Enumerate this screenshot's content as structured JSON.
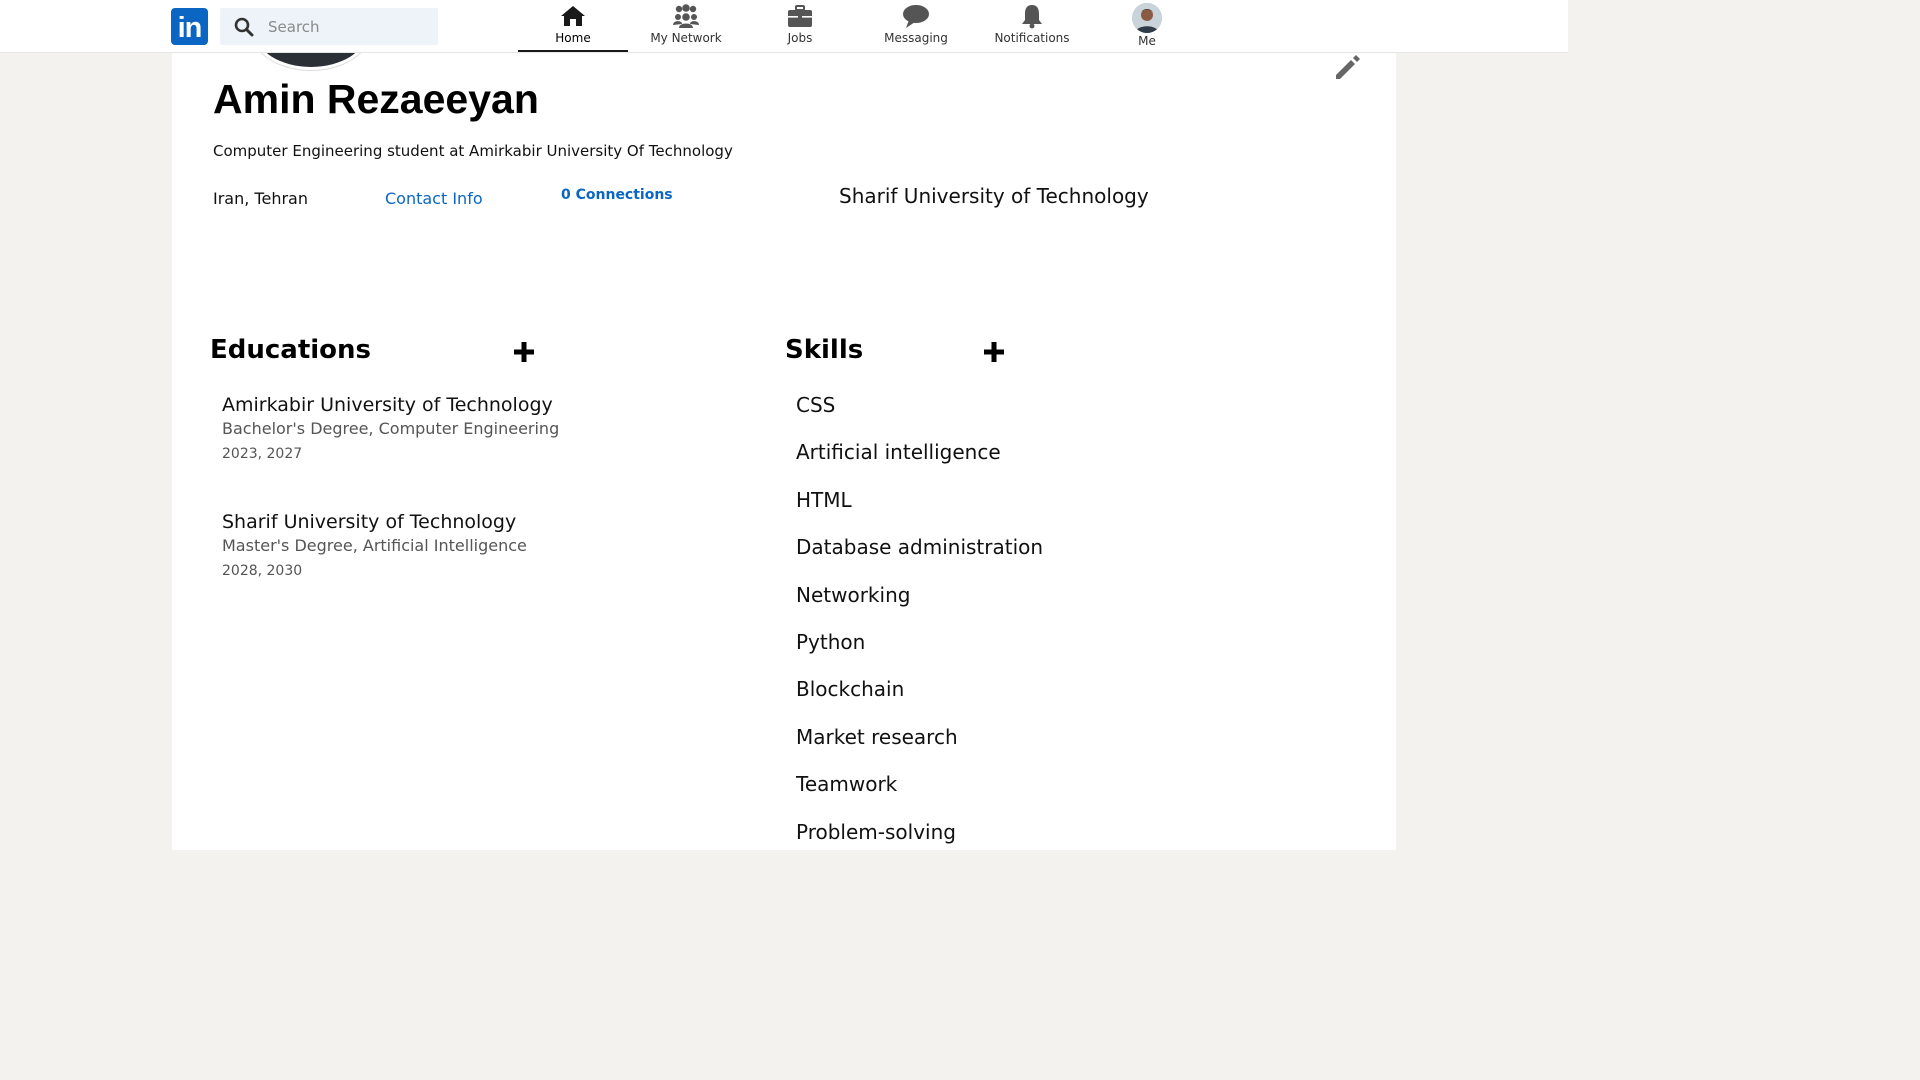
{
  "nav": {
    "logo_text": "in",
    "search_placeholder": "Search",
    "items": [
      {
        "label": "Home",
        "icon": "home-icon"
      },
      {
        "label": "My Network",
        "icon": "people-icon"
      },
      {
        "label": "Jobs",
        "icon": "briefcase-icon"
      },
      {
        "label": "Messaging",
        "icon": "chat-icon"
      },
      {
        "label": "Notifications",
        "icon": "bell-icon"
      },
      {
        "label": "Me",
        "icon": "avatar"
      }
    ],
    "active": "Home"
  },
  "profile": {
    "name": "Amin Rezaeeyan",
    "headline": "Computer Engineering student at Amirkabir University Of Technology",
    "location": "Iran, Tehran",
    "contact_label": "Contact Info",
    "connections": "0 Connections",
    "university": "Sharif University of Technology"
  },
  "educations": {
    "title": "Educations",
    "items": [
      {
        "school": "Amirkabir University of Technology",
        "degree": "Bachelor's Degree, Computer Engineering",
        "years": "2023, 2027"
      },
      {
        "school": "Sharif University of Technology",
        "degree": "Master's Degree, Artificial Intelligence",
        "years": "2028, 2030"
      }
    ]
  },
  "skills": {
    "title": "Skills",
    "items": [
      "CSS",
      "Artificial intelligence",
      "HTML",
      "Database administration",
      "Networking",
      "Python",
      "Blockchain",
      "Market research",
      "Teamwork",
      "Problem-solving"
    ]
  },
  "colors": {
    "brand": "#0a66c2",
    "page_bg": "#f3f2ef",
    "card_bg": "#ffffff",
    "search_bg": "#edf3f8"
  }
}
